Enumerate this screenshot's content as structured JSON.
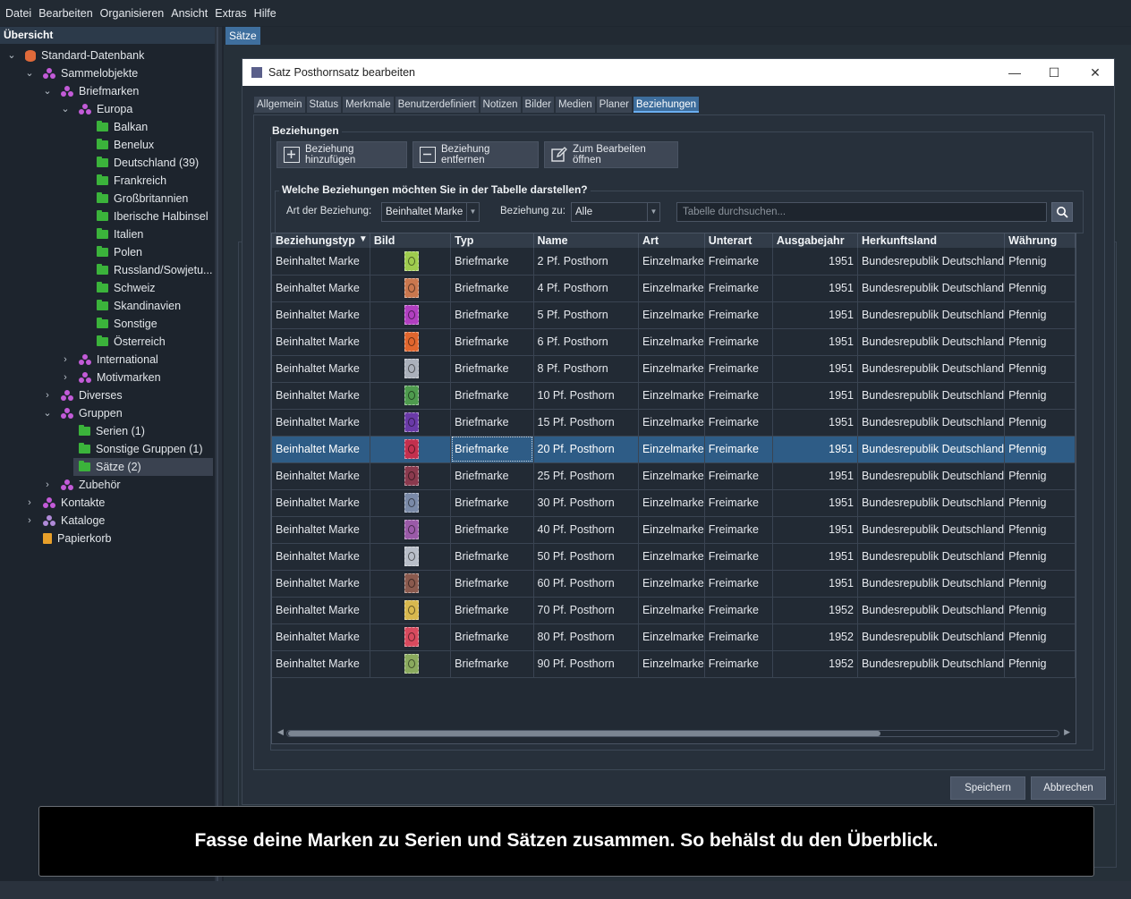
{
  "menubar": {
    "items": [
      "Datei",
      "Bearbeiten",
      "Organisieren",
      "Ansicht",
      "Extras",
      "Hilfe"
    ]
  },
  "sidebar": {
    "title": "Übersicht",
    "tree": [
      {
        "label": "Standard-Datenbank",
        "level": 0,
        "icon": "database-icon",
        "expanded": true
      },
      {
        "label": "Sammelobjekte",
        "level": 1,
        "icon": "collection-icon",
        "expanded": true
      },
      {
        "label": "Briefmarken",
        "level": 2,
        "icon": "collection-icon",
        "expanded": true
      },
      {
        "label": "Europa",
        "level": 3,
        "icon": "collection-icon",
        "expanded": true
      },
      {
        "label": "Balkan",
        "level": 4,
        "icon": "folder-icon"
      },
      {
        "label": "Benelux",
        "level": 4,
        "icon": "folder-icon"
      },
      {
        "label": "Deutschland (39)",
        "level": 4,
        "icon": "folder-icon"
      },
      {
        "label": "Frankreich",
        "level": 4,
        "icon": "folder-icon"
      },
      {
        "label": "Großbritannien",
        "level": 4,
        "icon": "folder-icon"
      },
      {
        "label": "Iberische Halbinsel",
        "level": 4,
        "icon": "folder-icon"
      },
      {
        "label": "Italien",
        "level": 4,
        "icon": "folder-icon"
      },
      {
        "label": "Polen",
        "level": 4,
        "icon": "folder-icon"
      },
      {
        "label": "Russland/Sowjetu...",
        "level": 4,
        "icon": "folder-icon"
      },
      {
        "label": "Schweiz",
        "level": 4,
        "icon": "folder-icon"
      },
      {
        "label": "Skandinavien",
        "level": 4,
        "icon": "folder-icon"
      },
      {
        "label": "Sonstige",
        "level": 4,
        "icon": "folder-icon"
      },
      {
        "label": "Österreich",
        "level": 4,
        "icon": "folder-icon"
      },
      {
        "label": "International",
        "level": 3,
        "icon": "collection-icon",
        "expanded": false
      },
      {
        "label": "Motivmarken",
        "level": 3,
        "icon": "collection-icon",
        "expanded": false
      },
      {
        "label": "Diverses",
        "level": 2,
        "icon": "collection-icon",
        "expanded": false
      },
      {
        "label": "Gruppen",
        "level": 2,
        "icon": "collection-icon",
        "expanded": true
      },
      {
        "label": "Serien (1)",
        "level": 3,
        "icon": "folder-icon"
      },
      {
        "label": "Sonstige Gruppen (1)",
        "level": 3,
        "icon": "folder-icon"
      },
      {
        "label": "Sätze (2)",
        "level": 3,
        "icon": "folder-icon",
        "selected": true
      },
      {
        "label": "Zubehör",
        "level": 2,
        "icon": "collection-icon",
        "expanded": false
      },
      {
        "label": "Kontakte",
        "level": 1,
        "icon": "collection-icon",
        "expanded": false
      },
      {
        "label": "Kataloge",
        "level": 1,
        "icon": "catalog-icon",
        "expanded": false
      },
      {
        "label": "Papierkorb",
        "level": 1,
        "icon": "trash-icon"
      }
    ]
  },
  "main_tab": "Sätze",
  "dialog": {
    "title": "Satz Posthornsatz bearbeiten",
    "tabs": [
      "Allgemein",
      "Status",
      "Merkmale",
      "Benutzerdefiniert",
      "Notizen",
      "Bilder",
      "Medien",
      "Planer",
      "Beziehungen"
    ],
    "active_tab": "Beziehungen",
    "group_title": "Beziehungen",
    "buttons": {
      "add": "Beziehung hinzufügen",
      "remove": "Beziehung entfernen",
      "open": "Zum Bearbeiten öffnen"
    },
    "filter": {
      "title": "Welche Beziehungen möchten Sie in der Tabelle darstellen?",
      "type_label": "Art der Beziehung:",
      "type_value": "Beinhaltet Marke",
      "to_label": "Beziehung zu:",
      "to_value": "Alle",
      "search_placeholder": "Tabelle durchsuchen..."
    },
    "table": {
      "columns": [
        "Beziehungstyp",
        "Bild",
        "Typ",
        "Name",
        "Art",
        "Unterart",
        "Ausgabejahr",
        "Herkunftsland",
        "Währung"
      ],
      "rows": [
        [
          "Beinhaltet Marke",
          "#9ecb4e",
          "Briefmarke",
          "2 Pf. Posthorn",
          "Einzelmarke",
          "Freimarke",
          "1951",
          "Bundesrepublik Deutschland",
          "Pfennig"
        ],
        [
          "Beinhaltet Marke",
          "#c9774e",
          "Briefmarke",
          "4 Pf. Posthorn",
          "Einzelmarke",
          "Freimarke",
          "1951",
          "Bundesrepublik Deutschland",
          "Pfennig"
        ],
        [
          "Beinhaltet Marke",
          "#b13fc0",
          "Briefmarke",
          "5 Pf. Posthorn",
          "Einzelmarke",
          "Freimarke",
          "1951",
          "Bundesrepublik Deutschland",
          "Pfennig"
        ],
        [
          "Beinhaltet Marke",
          "#e0662e",
          "Briefmarke",
          "6 Pf. Posthorn",
          "Einzelmarke",
          "Freimarke",
          "1951",
          "Bundesrepublik Deutschland",
          "Pfennig"
        ],
        [
          "Beinhaltet Marke",
          "#aab0bb",
          "Briefmarke",
          "8 Pf. Posthorn",
          "Einzelmarke",
          "Freimarke",
          "1951",
          "Bundesrepublik Deutschland",
          "Pfennig"
        ],
        [
          "Beinhaltet Marke",
          "#4e9a4e",
          "Briefmarke",
          "10 Pf. Posthorn",
          "Einzelmarke",
          "Freimarke",
          "1951",
          "Bundesrepublik Deutschland",
          "Pfennig"
        ],
        [
          "Beinhaltet Marke",
          "#6a3aa8",
          "Briefmarke",
          "15 Pf. Posthorn",
          "Einzelmarke",
          "Freimarke",
          "1951",
          "Bundesrepublik Deutschland",
          "Pfennig"
        ],
        [
          "Beinhaltet Marke",
          "#c3304e",
          "Briefmarke",
          "20 Pf. Posthorn",
          "Einzelmarke",
          "Freimarke",
          "1951",
          "Bundesrepublik Deutschland",
          "Pfennig"
        ],
        [
          "Beinhaltet Marke",
          "#8a3a4e",
          "Briefmarke",
          "25 Pf. Posthorn",
          "Einzelmarke",
          "Freimarke",
          "1951",
          "Bundesrepublik Deutschland",
          "Pfennig"
        ],
        [
          "Beinhaltet Marke",
          "#7a8aa8",
          "Briefmarke",
          "30 Pf. Posthorn",
          "Einzelmarke",
          "Freimarke",
          "1951",
          "Bundesrepublik Deutschland",
          "Pfennig"
        ],
        [
          "Beinhaltet Marke",
          "#9a5aa8",
          "Briefmarke",
          "40 Pf. Posthorn",
          "Einzelmarke",
          "Freimarke",
          "1951",
          "Bundesrepublik Deutschland",
          "Pfennig"
        ],
        [
          "Beinhaltet Marke",
          "#b8bec8",
          "Briefmarke",
          "50 Pf. Posthorn",
          "Einzelmarke",
          "Freimarke",
          "1951",
          "Bundesrepublik Deutschland",
          "Pfennig"
        ],
        [
          "Beinhaltet Marke",
          "#8a5a4e",
          "Briefmarke",
          "60 Pf. Posthorn",
          "Einzelmarke",
          "Freimarke",
          "1951",
          "Bundesrepublik Deutschland",
          "Pfennig"
        ],
        [
          "Beinhaltet Marke",
          "#d8b84e",
          "Briefmarke",
          "70 Pf. Posthorn",
          "Einzelmarke",
          "Freimarke",
          "1952",
          "Bundesrepublik Deutschland",
          "Pfennig"
        ],
        [
          "Beinhaltet Marke",
          "#d84a5e",
          "Briefmarke",
          "80 Pf. Posthorn",
          "Einzelmarke",
          "Freimarke",
          "1952",
          "Bundesrepublik Deutschland",
          "Pfennig"
        ],
        [
          "Beinhaltet Marke",
          "#8aaa5e",
          "Briefmarke",
          "90 Pf. Posthorn",
          "Einzelmarke",
          "Freimarke",
          "1952",
          "Bundesrepublik Deutschland",
          "Pfennig"
        ]
      ],
      "selected_row": 7
    },
    "save_label": "Speichern",
    "cancel_label": "Abbrechen"
  },
  "banner": "Fasse deine Marken zu Serien und Sätzen zusammen. So behälst du den Überblick.",
  "colors": {
    "accent": "#3d6d9c",
    "selection": "#2e5c86",
    "folder": "#3bb33b",
    "collection": "#c35bd8"
  }
}
